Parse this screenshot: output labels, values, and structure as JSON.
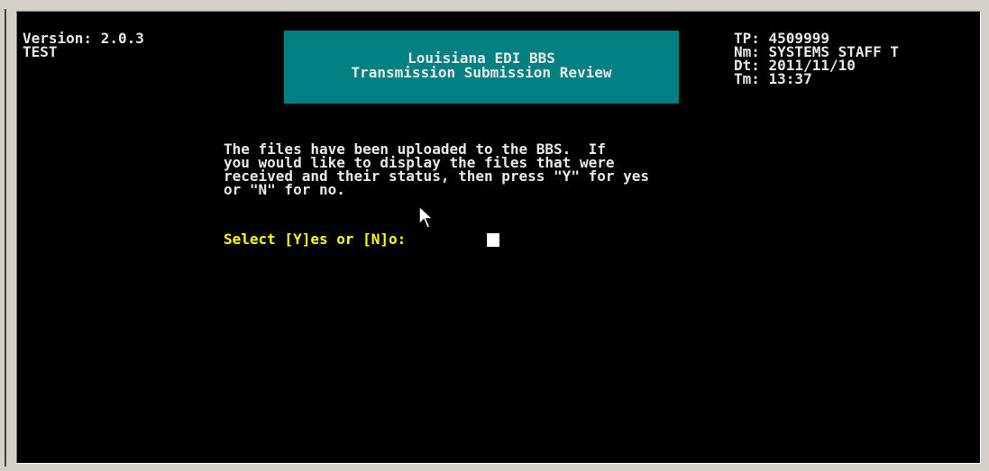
{
  "header": {
    "version": "Version: 2.0.3",
    "environment": "TEST",
    "banner_line1": "Louisiana EDI BBS",
    "banner_line2": "Transmission Submission Review",
    "tp": "TP: 4509999",
    "name": "Nm: SYSTEMS STAFF T",
    "date": "Dt: 2011/11/10",
    "time": "Tm: 13:37"
  },
  "message": {
    "line1": "The files have been uploaded to the BBS.  If",
    "line2": "you would like to display the files that were",
    "line3": "received and their status, then press \"Y\" for yes",
    "line4": "or \"N\" for no."
  },
  "prompt": {
    "label": "Select [Y]es or [N]o:"
  },
  "colors": {
    "background": "#000000",
    "text": "#e8e8e8",
    "banner": "#008080",
    "prompt": "#ffff00",
    "window_chrome": "#d4d0c8"
  },
  "icons": {
    "pointer": "mouse-pointer-icon",
    "cursor": "text-cursor-block"
  }
}
